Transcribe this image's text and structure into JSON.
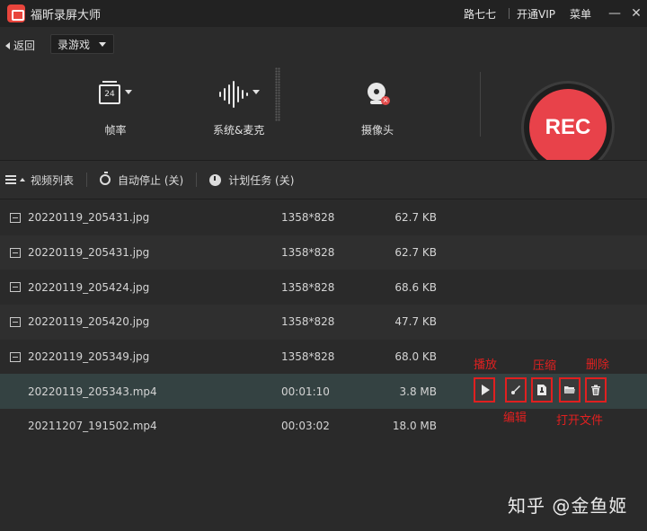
{
  "app": {
    "title": "福昕录屏大师",
    "user": "路七七",
    "vip": "开通VIP",
    "menu": "菜单",
    "minimize": "—",
    "close": "✕"
  },
  "toolbar": {
    "back": "返回",
    "mode": "录游戏",
    "tools": [
      {
        "label": "帧率",
        "icon": "fps-icon",
        "value": "24"
      },
      {
        "label": "系统&麦克",
        "icon": "soundwave-icon"
      },
      {
        "label": "摄像头",
        "icon": "webcam-icon"
      }
    ],
    "rec": "REC",
    "rec_color": "#e8424a"
  },
  "subbar": {
    "list": "视频列表",
    "autostop": "自动停止 (关)",
    "schedule": "计划任务 (关)"
  },
  "files": [
    {
      "name": "20220119_205431.jpg",
      "info": "1358*828",
      "size": "62.7 KB",
      "type": "image"
    },
    {
      "name": "20220119_205431.jpg",
      "info": "1358*828",
      "size": "62.7 KB",
      "type": "image"
    },
    {
      "name": "20220119_205424.jpg",
      "info": "1358*828",
      "size": "68.6 KB",
      "type": "image"
    },
    {
      "name": "20220119_205420.jpg",
      "info": "1358*828",
      "size": "47.7 KB",
      "type": "image"
    },
    {
      "name": "20220119_205349.jpg",
      "info": "1358*828",
      "size": "68.0 KB",
      "type": "image"
    },
    {
      "name": "20220119_205343.mp4",
      "info": "00:01:10",
      "size": "3.8 MB",
      "type": "video"
    },
    {
      "name": "20211207_191502.mp4",
      "info": "00:03:02",
      "size": "18.0 MB",
      "type": "video"
    }
  ],
  "annotations": {
    "play": "播放",
    "edit": "编辑",
    "compress": "压缩",
    "open": "打开文件",
    "delete": "删除"
  },
  "annotation_color": "#e02020",
  "watermark": "知乎 @金鱼姬"
}
